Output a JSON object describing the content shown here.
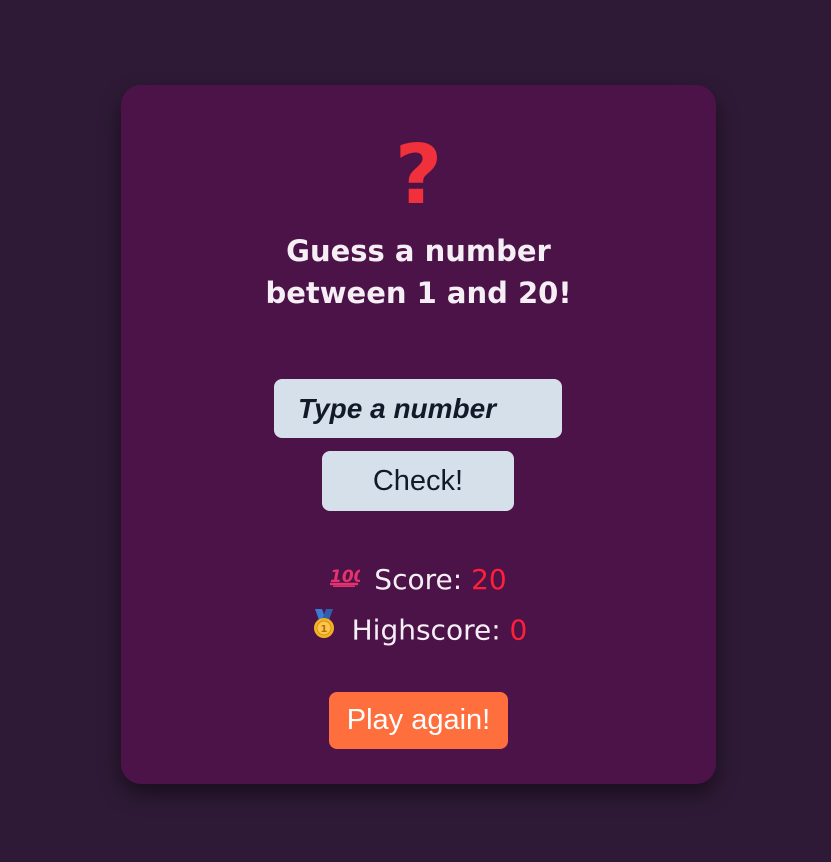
{
  "game": {
    "icon": "question-mark-icon",
    "icon_glyph": "?",
    "title": "Guess a number\nbetween 1 and 20!",
    "input": {
      "placeholder": "Type a number",
      "value": ""
    },
    "check_label": "Check!",
    "score": {
      "icon": "hundred-points-icon",
      "label": "Score: ",
      "value": "20"
    },
    "highscore": {
      "icon": "medal-icon",
      "label": "Highscore: ",
      "value": "0"
    },
    "play_again_label": "Play again!"
  },
  "colors": {
    "background": "#2e1a36",
    "card": "#4c1348",
    "question_mark": "#f0303a",
    "score_value": "#ff1f3a",
    "input_bg": "#d6e0ea",
    "play_again_bg": "#ff6e3d"
  }
}
